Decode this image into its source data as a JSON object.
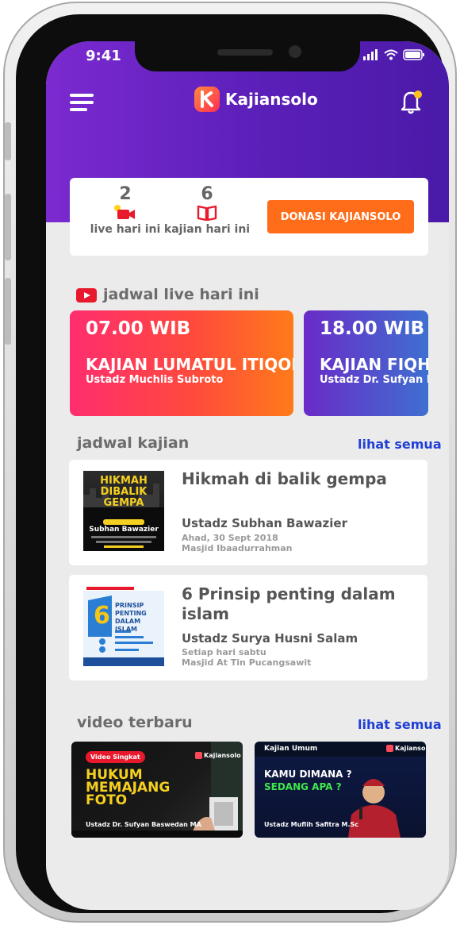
{
  "status_bar": {
    "time": "9:41"
  },
  "header": {
    "app_name": "Kajiansolo"
  },
  "stats": [
    {
      "count": "2",
      "label": "live hari ini",
      "icon": "video-icon"
    },
    {
      "count": "6",
      "label": "kajian hari ini",
      "icon": "book-icon"
    }
  ],
  "donate_label": "DONASI KAJIANSOLO",
  "live_section": {
    "title": "jadwal live hari ini"
  },
  "live_cards": [
    {
      "time": "07.00 WIB",
      "title": "KAJIAN LUMATUL ITIQOD",
      "speaker": "Ustadz Muchlis Subroto"
    },
    {
      "time": "18.00 WIB",
      "title": "KAJIAN FIQH",
      "speaker": "Ustadz Dr. Sufyan B"
    }
  ],
  "kajian_section": {
    "title": "jadwal kajian",
    "see_all": "lihat semua"
  },
  "kajian_list": [
    {
      "title": "Hikmah di balik gempa",
      "speaker": "Ustadz Subhan Bawazier",
      "date": "Ahad, 30 Sept 2018",
      "place": "Masjid Ibaadurrahman",
      "poster": {
        "heading": "HIKMAH DIBALIK GEMPA",
        "name": "Subhan Bawazier"
      }
    },
    {
      "title": "6 Prinsip penting dalam islam",
      "speaker": "Ustadz Surya Husni Salam",
      "date": "Setiap hari sabtu",
      "place": "Masjid At Tin Pucangsawit",
      "poster": {
        "number": "6",
        "heading": "PRINSIP PENTING DALAM ISLAM"
      }
    }
  ],
  "video_section": {
    "title": "video terbaru",
    "see_all": "lihat semua"
  },
  "videos": [
    {
      "badge": "Video Singkat",
      "headline": "HUKUM MEMAJANG FOTO",
      "speaker": "Ustadz Dr. Sufyan Baswedan MA",
      "brand": "Kajiansolo"
    },
    {
      "category": "Kajian Umum",
      "headline_1": "KAMU DIMANA ?",
      "headline_2": "SEDANG APA ?",
      "speaker": "Ustadz Muflih Safitra M.Sc",
      "brand": "Kajiansolo"
    }
  ],
  "colors": {
    "accent_orange": "#ff6d1a",
    "header_purple": "#5a1fb8",
    "link_blue": "#1f3fd6",
    "live_red": "#e8192c"
  }
}
